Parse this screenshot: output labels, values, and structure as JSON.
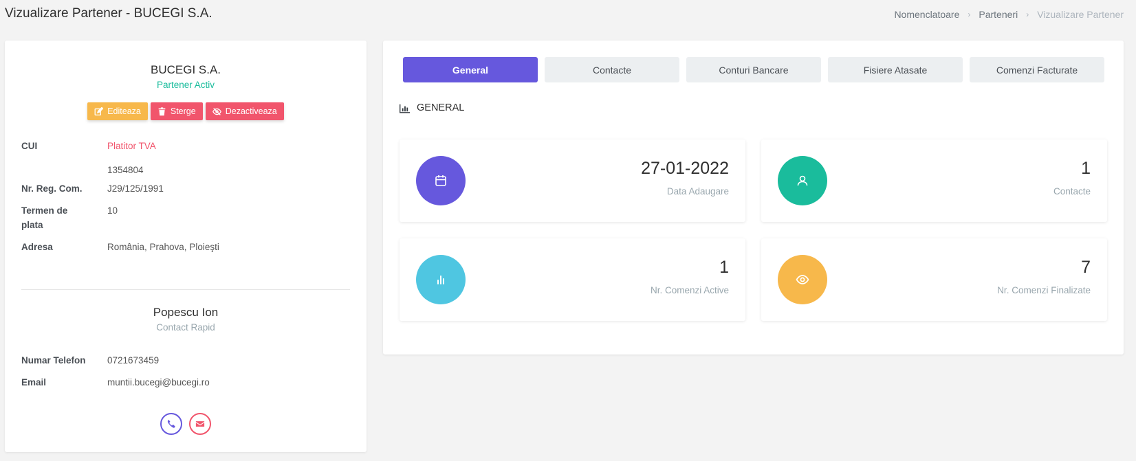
{
  "page": {
    "title": "Vizualizare Partener - BUCEGI S.A.",
    "breadcrumb": [
      "Nomenclatoare",
      "Parteneri",
      "Vizualizare Partener"
    ]
  },
  "partner": {
    "name": "BUCEGI S.A.",
    "status": "Partener Activ",
    "actions": {
      "edit": "Editeaza",
      "delete": "Sterge",
      "deactivate": "Dezactiveaza"
    },
    "fields": {
      "cui_label": "CUI",
      "cui_tva": "Platitor TVA",
      "cui_value": "1354804",
      "reg_label": "Nr. Reg. Com.",
      "reg_value": "J29/125/1991",
      "term_label_1": "Termen de",
      "term_label_2": "plata",
      "term_value": "10",
      "address_label": "Adresa",
      "address_value": "România, Prahova, Ploieşti"
    }
  },
  "contact": {
    "name": "Popescu Ion",
    "subtitle": "Contact Rapid",
    "phone_label": "Numar Telefon",
    "phone_value": "0721673459",
    "email_label": "Email",
    "email_value": "muntii.bucegi@bucegi.ro"
  },
  "tabs": [
    "General",
    "Contacte",
    "Conturi Bancare",
    "Fisiere Atasate",
    "Comenzi Facturate"
  ],
  "section": {
    "title": "GENERAL"
  },
  "stats": [
    {
      "value": "27-01-2022",
      "label": "Data Adaugare",
      "icon": "calendar-icon",
      "color": "#6658dd"
    },
    {
      "value": "1",
      "label": "Contacte",
      "icon": "user-icon",
      "color": "#1abc9c"
    },
    {
      "value": "1",
      "label": "Nr. Comenzi Active",
      "icon": "bar-chart-icon",
      "color": "#4fc6e1"
    },
    {
      "value": "7",
      "label": "Nr. Comenzi Finalizate",
      "icon": "eye-icon",
      "color": "#f7b84b"
    }
  ],
  "colors": {
    "primary": "#6658dd",
    "success": "#1abc9c",
    "danger": "#f1556c",
    "warning": "#f7b84b",
    "info": "#4fc6e1"
  }
}
